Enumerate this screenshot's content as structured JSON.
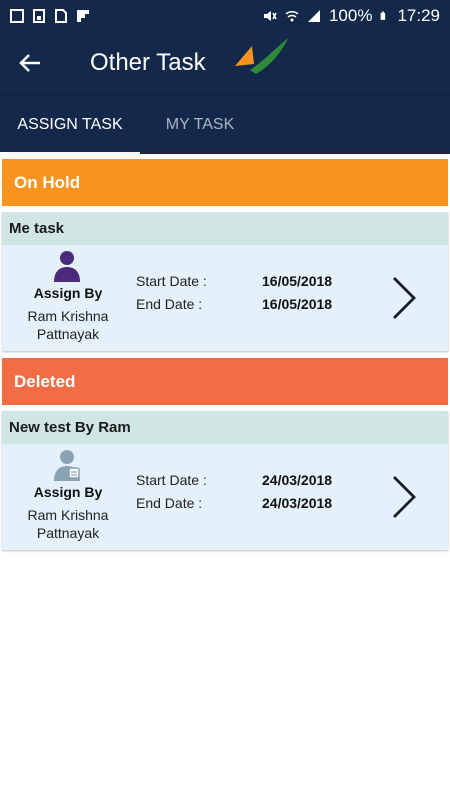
{
  "status_bar": {
    "battery": "100%",
    "time": "17:29"
  },
  "app_bar": {
    "title": "Other Task"
  },
  "tabs": [
    {
      "label": "ASSIGN TASK",
      "active": true
    },
    {
      "label": "MY TASK",
      "active": false
    }
  ],
  "sections": [
    {
      "header": "On Hold",
      "color": "#f7931e",
      "card": {
        "title": "Me task",
        "assign_label": "Assign By",
        "assign_name_line1": "Ram Krishna",
        "assign_name_line2": "Pattnayak",
        "start_label": "Start Date :",
        "start_date": "16/05/2018",
        "end_label": "End Date :",
        "end_date": "16/05/2018",
        "avatar_icon": "user-purple-icon"
      }
    },
    {
      "header": "Deleted",
      "color": "#f26d45",
      "card": {
        "title": "New test By Ram",
        "assign_label": "Assign By",
        "assign_name_line1": "Ram Krishna",
        "assign_name_line2": "Pattnayak",
        "start_label": "Start Date :",
        "start_date": "24/03/2018",
        "end_label": "End Date :",
        "end_date": "24/03/2018",
        "avatar_icon": "user-gray-icon"
      }
    }
  ]
}
